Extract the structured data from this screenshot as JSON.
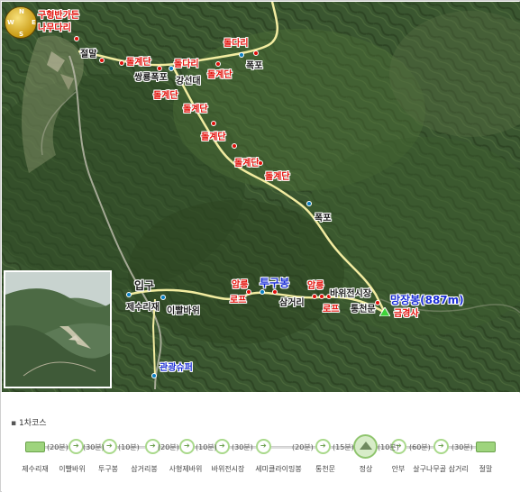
{
  "map": {
    "compass": {
      "n": "N",
      "s": "S",
      "e": "E",
      "w": "W"
    },
    "labels": {
      "top_left_title_1": "구형반가든",
      "top_left_title_2": "다리",
      "top_left_prefix": "나무",
      "jeolmal": "절말",
      "dolgyedan_1": "돌계단",
      "sangryong": "쌍룡폭포",
      "doldari_1": "돌다리",
      "gangseondae": "강선대",
      "doldari_2": "돌다리",
      "dolgyedan_2": "돌계단",
      "pokpo_1": "폭포",
      "dolgyedan_3": "돌계단",
      "dolgyedan_4": "돌계단",
      "dolgyedan_5": "돌계단",
      "dolgyedan_6": "돌계단",
      "dolgyedan_7": "돌계단",
      "pokpo_2": "폭포",
      "ipgu": "입구",
      "jesurijae": "제수리재",
      "ippalbawi": "이빨바위",
      "amreung_1": "암릉",
      "rope_1": "로프",
      "tugubong": "투구봉",
      "samgeori": "삼거리",
      "amreung_2": "암릉",
      "rope_2": "로프",
      "bawijeonsijang": "바위전시장",
      "tongcheonmun": "통천문",
      "manjangbong": "망장봉(887m)",
      "geumgyeongsa": "금경사",
      "gwangyeongsiri": "관광슈퍼"
    }
  },
  "course": {
    "title": "1차코스",
    "bullet": "▪",
    "times": [
      "(20분)",
      "(30분)",
      "(10분)",
      "(20분)",
      "(10분)",
      "(30분)",
      "(20분)",
      "(15분)",
      "(10분)",
      "(60분)",
      "(30분)"
    ],
    "stops": [
      "제수리재",
      "이빨바위",
      "투구봉",
      "삼거리봉",
      "사형제바위",
      "바위전시장",
      "세미클라이밍봉",
      "통천문",
      "정상",
      "안부",
      "살구나무골 삼거리",
      "절말"
    ]
  },
  "colors": {
    "route": "#f2eca0",
    "label_red": "#e3120b",
    "label_blue": "#1b2fd6",
    "node_green": "#9ed47d"
  }
}
